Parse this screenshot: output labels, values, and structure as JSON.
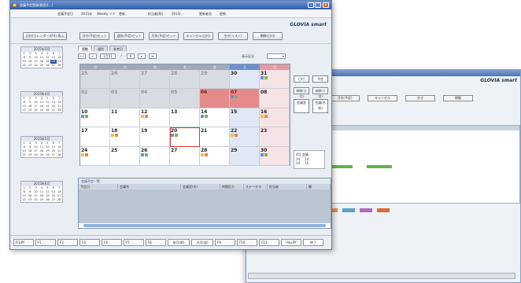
{
  "front_window": {
    "title": "会議予定登録(照会)[…]",
    "brand": "GLOVIA smart",
    "info": [
      "会議予定日",
      "2015年",
      "Weekly イチ",
      "更新",
      "担当者(照)",
      "2015/…",
      "更新者名",
      "更新"
    ],
    "top_buttons": [
      "日付(カレンダー)(F4) 表示",
      "日付(予定)セット",
      "週別(予定)セット",
      "月別(予定)セット",
      "キャンセル(日付)",
      "空き(リスト)",
      "期間(日付)"
    ],
    "tabs": [
      "月別",
      "週別",
      "参考日"
    ],
    "nav": [
      "<<",
      "<",
      "1月01",
      "/",
      "0",
      "▸",
      "≫"
    ],
    "nav_label": "表示区分",
    "weekdays": [
      "月",
      "火",
      "水",
      "木",
      "金",
      "土",
      "日"
    ],
    "right_buttons": [
      "日付",
      "予定",
      "期間(日付)",
      "週間(日付)",
      "会議室",
      "会議(名前)",
      "日付 期間"
    ],
    "right_box_title": "4月 会議",
    "right_box_values": [
      "14",
      "14",
      "14",
      "15"
    ],
    "list_title": "会議予定一覧",
    "list_columns": [
      "予定日",
      "会議名",
      "会議室(名)",
      "時間区分",
      "ステータス",
      "担当者",
      "備"
    ],
    "footer_keys": [
      "Fi1/Pf",
      "F1",
      "F2",
      "F3",
      "F4",
      "F5",
      "F6",
      "前月(前)",
      "次月(翌)",
      "F9",
      "F10",
      "F11",
      "Plus/Pf",
      "終了"
    ]
  },
  "calendar": {
    "rows": [
      [
        {
          "d": "25",
          "t": "off"
        },
        {
          "d": "26",
          "t": "off"
        },
        {
          "d": "27",
          "t": "off"
        },
        {
          "d": "28",
          "t": "off"
        },
        {
          "d": "29",
          "t": "off"
        },
        {
          "d": "30",
          "t": "sat"
        },
        {
          "d": "31",
          "t": "sun"
        }
      ],
      [
        {
          "d": "02",
          "t": "off"
        },
        {
          "d": "03",
          "t": "off"
        },
        {
          "d": "04",
          "t": "off"
        },
        {
          "d": "05",
          "t": "off"
        },
        {
          "d": "06",
          "t": "hol"
        },
        {
          "d": "07",
          "t": "hol"
        },
        {
          "d": "08",
          "t": "sun"
        }
      ],
      [
        {
          "d": "10",
          "t": ""
        },
        {
          "d": "11",
          "t": ""
        },
        {
          "d": "12",
          "t": ""
        },
        {
          "d": "13",
          "t": ""
        },
        {
          "d": "14",
          "t": ""
        },
        {
          "d": "15",
          "t": "sat"
        },
        {
          "d": "16",
          "t": "sun"
        }
      ],
      [
        {
          "d": "17",
          "t": ""
        },
        {
          "d": "18",
          "t": ""
        },
        {
          "d": "19",
          "t": ""
        },
        {
          "d": "20",
          "t": "today"
        },
        {
          "d": "21",
          "t": ""
        },
        {
          "d": "22",
          "t": "sat"
        },
        {
          "d": "23",
          "t": "sun"
        }
      ],
      [
        {
          "d": "24",
          "t": ""
        },
        {
          "d": "25",
          "t": ""
        },
        {
          "d": "26",
          "t": ""
        },
        {
          "d": "27",
          "t": ""
        },
        {
          "d": "28",
          "t": ""
        },
        {
          "d": "29",
          "t": "sat"
        },
        {
          "d": "30",
          "t": "sun"
        }
      ]
    ]
  },
  "mini_calendars": [
    {
      "title": "2015年3月",
      "nums": [
        "1",
        "2",
        "3",
        "4",
        "5",
        "6",
        "7",
        "8",
        "9",
        "10",
        "11",
        "12",
        "13",
        "14",
        "15",
        "16",
        "17",
        "18",
        "19",
        "20",
        "21",
        "22",
        "23",
        "24",
        "25",
        "26",
        "27",
        "28"
      ]
    },
    {
      "title": "2015年4月",
      "nums": [
        "1",
        "2",
        "3",
        "4",
        "5",
        "6",
        "7",
        "8",
        "9",
        "10",
        "11",
        "12",
        "13",
        "14",
        "15",
        "16",
        "17",
        "18",
        "19",
        "20",
        "21",
        "22",
        "23",
        "24",
        "25",
        "26",
        "27",
        "28"
      ]
    },
    {
      "title": "2015年5月",
      "nums": [
        "1",
        "2",
        "3",
        "4",
        "5",
        "6",
        "7",
        "8",
        "9",
        "10",
        "11",
        "12",
        "13",
        "14",
        "15",
        "16",
        "17",
        "18",
        "19",
        "20",
        "21",
        "22",
        "23",
        "24",
        "25",
        "26",
        "27",
        "28"
      ]
    },
    {
      "title": "2015年6月",
      "nums": [
        "1",
        "2",
        "3",
        "4",
        "5",
        "6",
        "7",
        "8",
        "9",
        "10",
        "11",
        "12",
        "13",
        "14",
        "15",
        "16",
        "17",
        "18",
        "19",
        "20",
        "21",
        "22",
        "23",
        "24",
        "25",
        "26",
        "27",
        "28"
      ]
    }
  ],
  "back_window": {
    "brand": "GLOVIA smart",
    "buttons": [
      "日付",
      "日付(予定)",
      "月別(予定)",
      "キャンセル",
      "空き",
      "期間"
    ],
    "gantt_header": "時間"
  },
  "colors": {
    "title": "#2f5ca8",
    "holiday": "#e58a8a",
    "saturday": "#e0e8f6",
    "sunday": "#f6e3e5",
    "today_border": "#dd3333"
  }
}
